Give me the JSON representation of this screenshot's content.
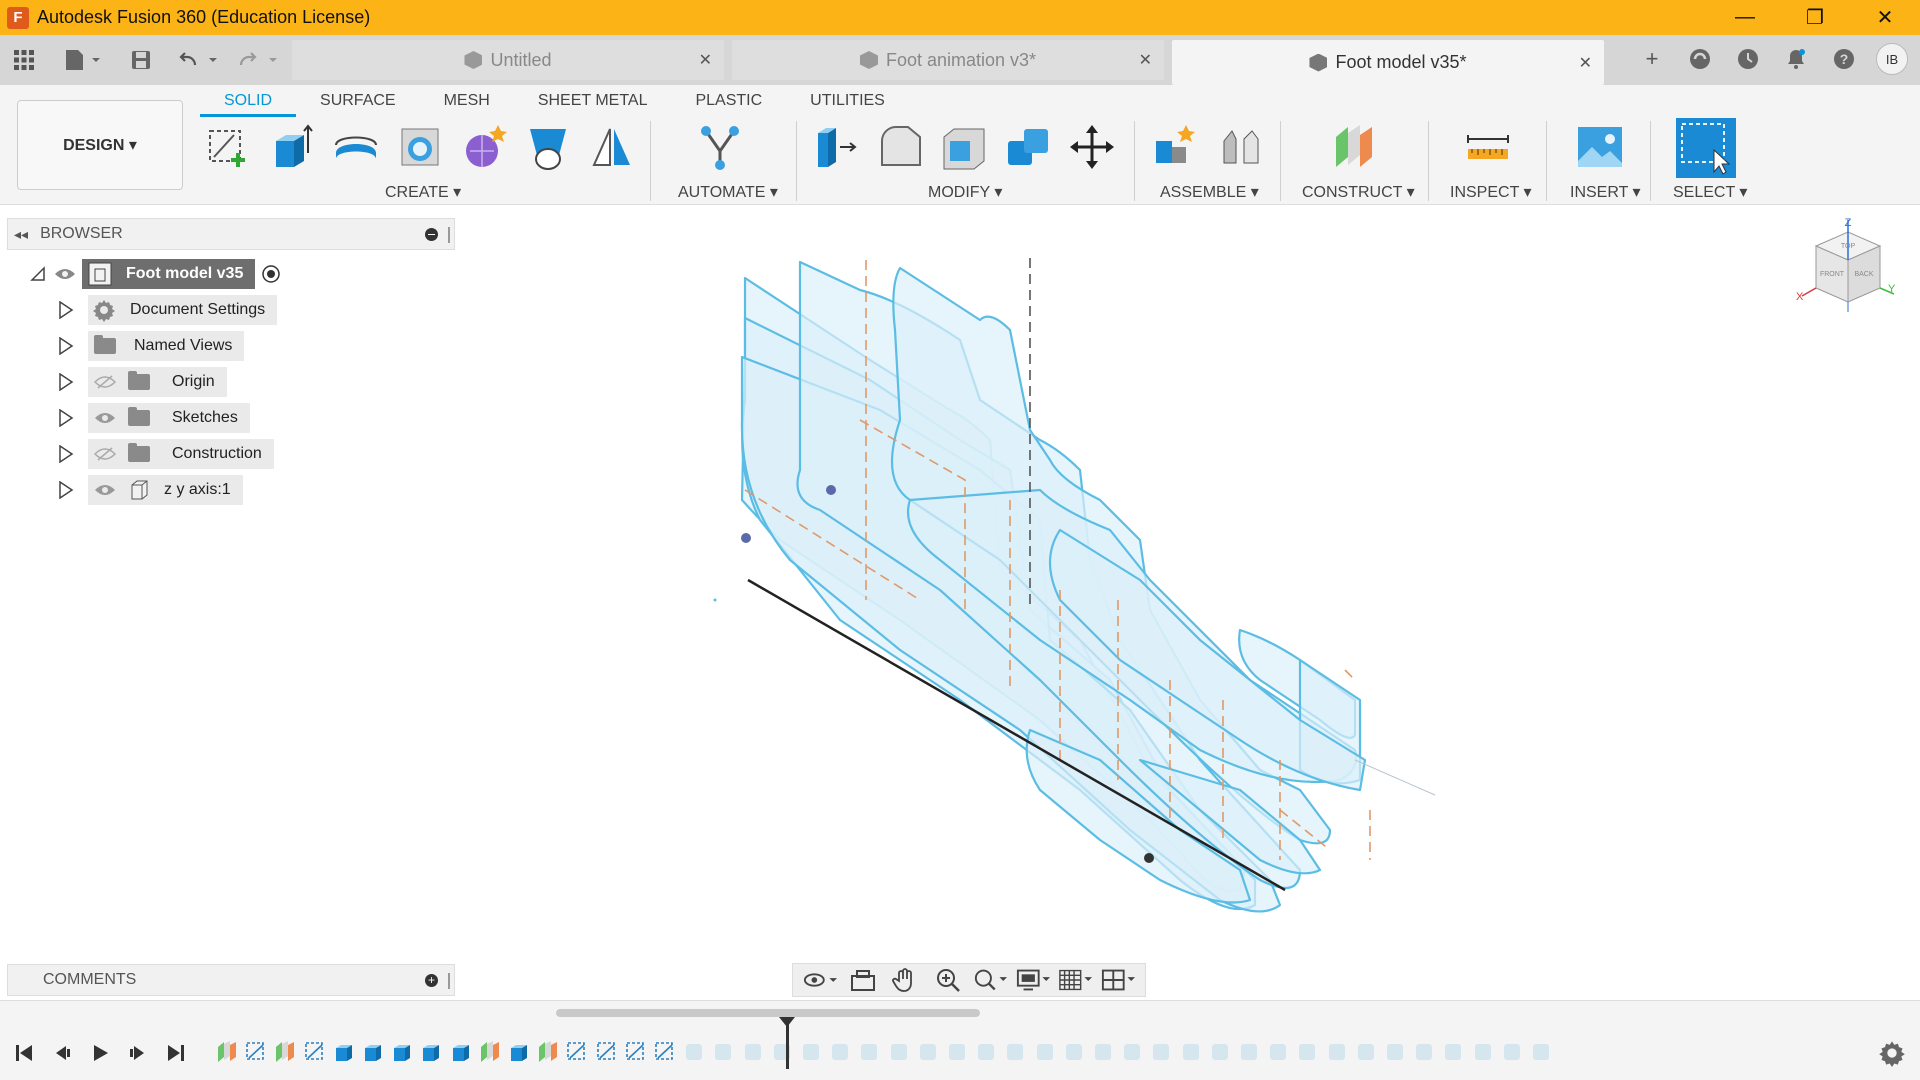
{
  "window": {
    "title": "Autodesk Fusion 360 (Education License)",
    "logo_letter": "F",
    "minimize": "—",
    "maximize": "❐",
    "close": "✕"
  },
  "tabs": [
    {
      "label": "Untitled",
      "close": "✕"
    },
    {
      "label": "Foot animation v3*",
      "close": "✕"
    },
    {
      "label": "Foot model v35*",
      "close": "✕"
    }
  ],
  "toolbar": {
    "new_tab": "+",
    "user_initials": "IB"
  },
  "ribbon": {
    "workspace": "DESIGN ▾",
    "tabs": [
      "SOLID",
      "SURFACE",
      "MESH",
      "SHEET METAL",
      "PLASTIC",
      "UTILITIES"
    ],
    "active_tab": "SOLID",
    "groups": [
      "CREATE ▾",
      "AUTOMATE ▾",
      "MODIFY ▾",
      "ASSEMBLE ▾",
      "CONSTRUCT ▾",
      "INSPECT ▾",
      "INSERT ▾",
      "SELECT ▾"
    ]
  },
  "browser": {
    "title": "BROWSER",
    "collapse": "◂◂",
    "root": "Foot model v35",
    "items": [
      {
        "label": "Document Settings",
        "icon": "gear-icon"
      },
      {
        "label": "Named Views",
        "icon": "folder-icon"
      },
      {
        "label": "Origin",
        "icon": "folder-icon",
        "visible": false
      },
      {
        "label": "Sketches",
        "icon": "folder-icon",
        "visible": true
      },
      {
        "label": "Construction",
        "icon": "folder-icon",
        "visible": false
      },
      {
        "label": "z y axis:1",
        "icon": "body-icon",
        "visible": true
      }
    ]
  },
  "comments": {
    "title": "COMMENTS",
    "add": "+"
  },
  "viewcube": {
    "top": "TOP",
    "front": "FRONT",
    "right": "BACK",
    "axis_x": "X",
    "axis_y": "Y",
    "axis_z": "Z"
  },
  "colors": {
    "title_bar": "#fcb316",
    "accent": "#0696d7",
    "sketch_stroke": "#5bbde4",
    "sketch_fill": "#dcf0fa"
  }
}
